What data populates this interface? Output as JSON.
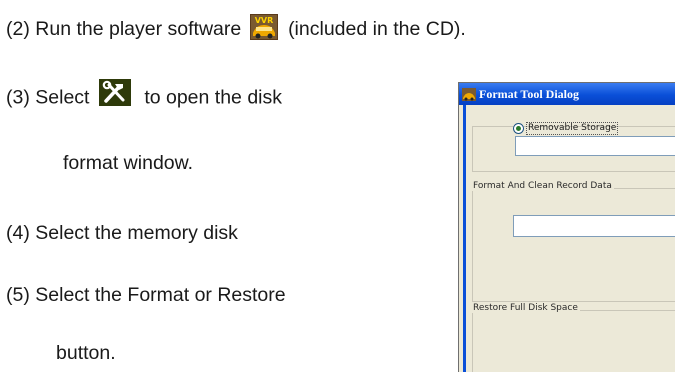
{
  "instructions": [
    {
      "step": "(2)",
      "text_before": "Run the player software",
      "text_after": "(included in the CD).",
      "icon": "player-software-icon"
    },
    {
      "step": "(3)",
      "text_before": "Select",
      "text_after": "to open the disk",
      "icon": "tools-hammer-wrench-icon"
    },
    {
      "continuation": "format window."
    },
    {
      "step": "(4)",
      "text": "Select the memory disk"
    },
    {
      "step": "(5)",
      "text": "Select the Format or Restore"
    },
    {
      "continuation": "button."
    }
  ],
  "dialog": {
    "title": "Format Tool Dialog",
    "removable_storage_label": "Removable Storage",
    "format_group_label": "Format And Clean Record Data",
    "restore_group_label": "Restore Full Disk Space"
  },
  "colors": {
    "titlebar": "#0a4fd8",
    "dialog_face": "#ece9d8",
    "tool_icon_bg": "#2e3a0a",
    "tool_icon_fg": "#ffffff"
  }
}
